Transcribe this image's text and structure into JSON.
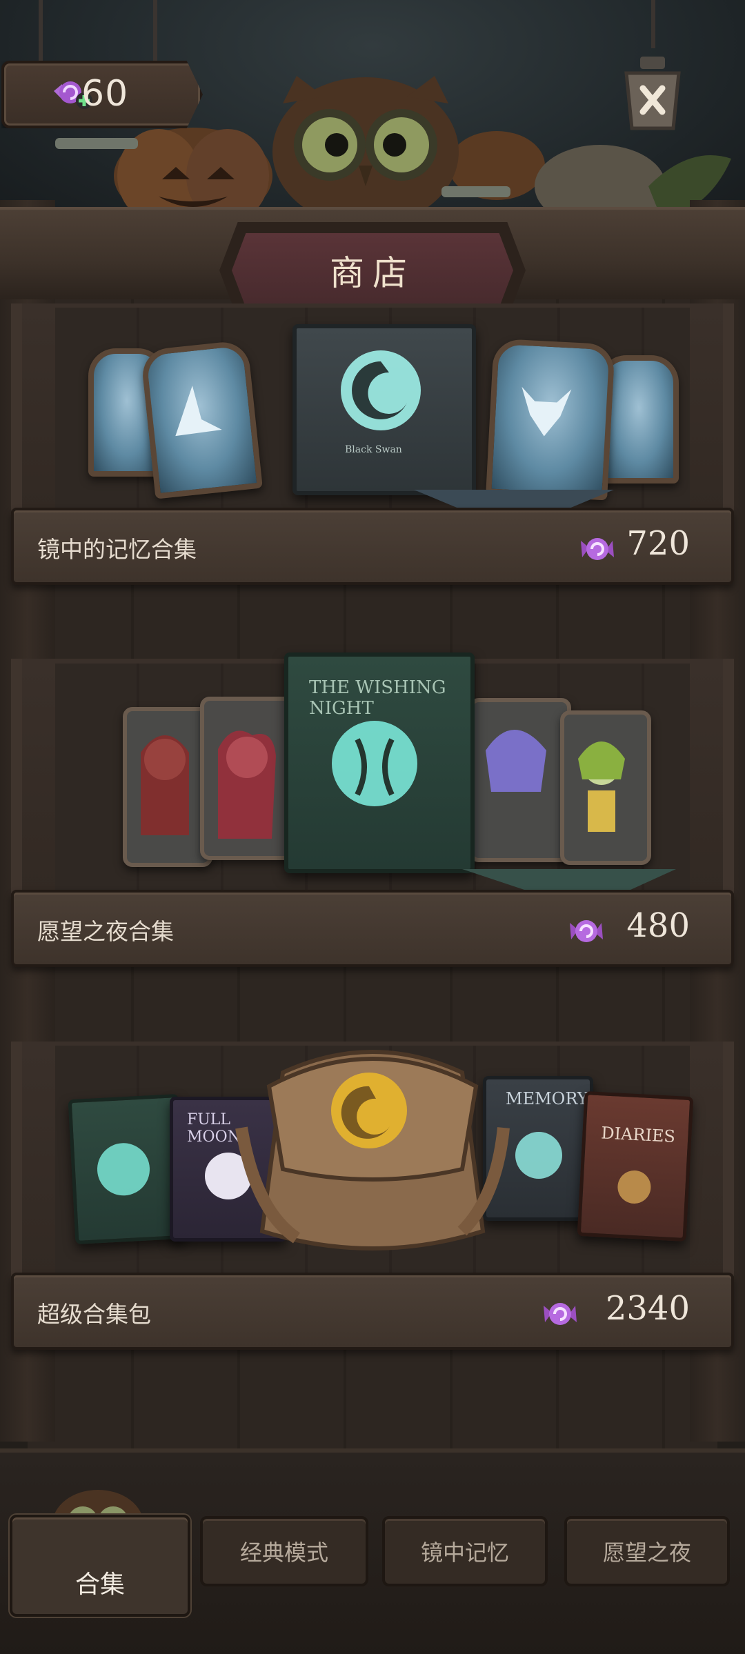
{
  "header": {
    "candy_amount": "60",
    "title": "商店",
    "close_icon": "close-lantern-icon"
  },
  "shop": {
    "items": [
      {
        "label": "镜中的记忆合集",
        "price": "720",
        "currency_icon": "candy-icon"
      },
      {
        "label": "愿望之夜合集",
        "price": "480",
        "currency_icon": "candy-icon"
      },
      {
        "label": "超级合集包",
        "price": "2340",
        "currency_icon": "candy-icon"
      }
    ]
  },
  "artwork_text": {
    "black_swan": "Black Swan",
    "wishing_night": "THE WISHING NIGHT",
    "full_moon": "FULL MOON",
    "memory": "MEMORY",
    "diaries": "DIARIES"
  },
  "nav": {
    "tabs": [
      {
        "label": "合集",
        "active": true
      },
      {
        "label": "经典模式",
        "active": false
      },
      {
        "label": "镜中记忆",
        "active": false
      },
      {
        "label": "愿望之夜",
        "active": false
      }
    ]
  },
  "colors": {
    "candy_purple": "#9b4fc0",
    "plus_green": "#5fd07a",
    "title_banner": "#4f2e31",
    "glow_cyan": "#7ff0e0"
  }
}
